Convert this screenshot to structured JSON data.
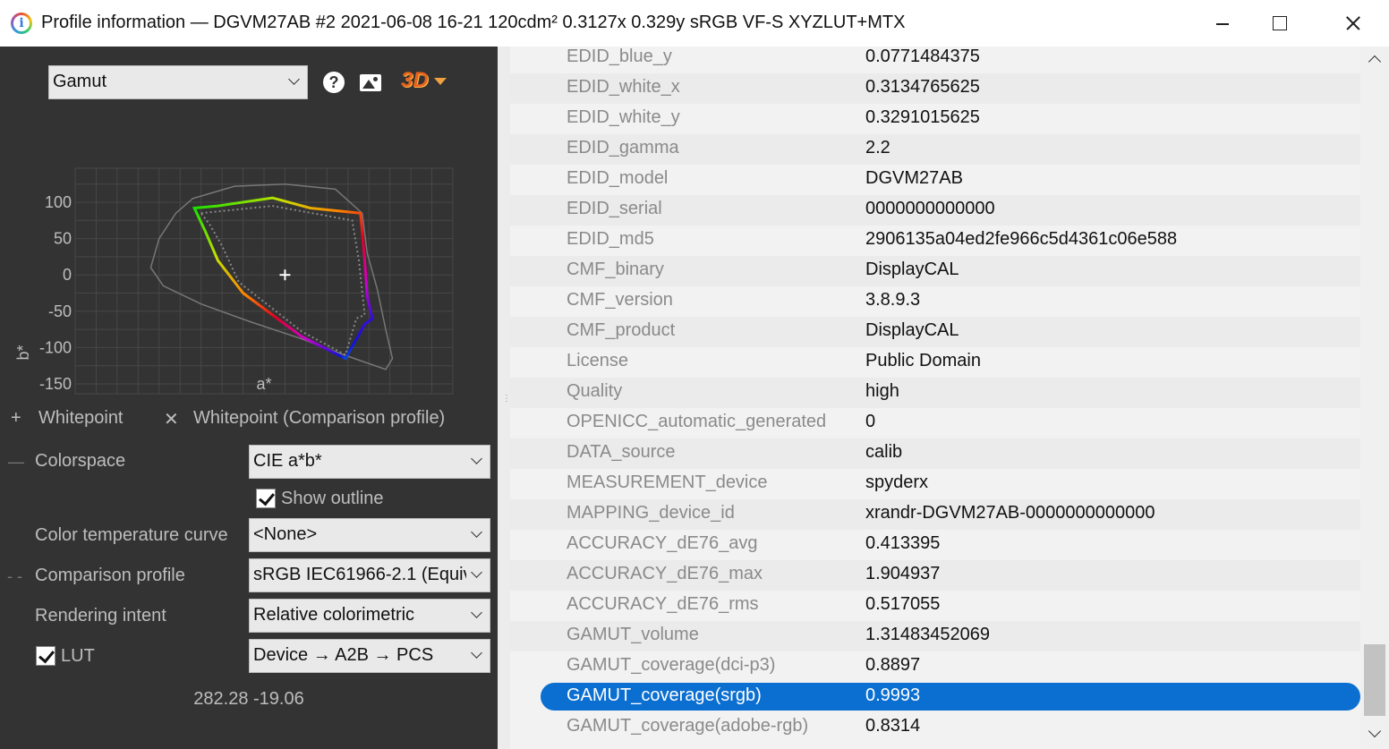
{
  "window": {
    "title": "Profile information — DGVM27AB #2 2021-06-08 16-21 120cdm² 0.3127x 0.329y sRGB VF-S XYZLUT+MTX",
    "app_icon_glyph": "i"
  },
  "toolbar": {
    "view_select": "Gamut",
    "help_icon": "?",
    "threed_label": "3D"
  },
  "chart_data": {
    "type": "scatter",
    "xlabel": "a*",
    "ylabel": "b*",
    "xlim": [
      -250,
      200
    ],
    "ylim": [
      -150,
      100
    ],
    "xticks": [
      "-250",
      "-200",
      "-150",
      "-100",
      "-50",
      "0",
      "50",
      "100",
      "150",
      "200"
    ],
    "yticks": [
      "100",
      "50",
      "0",
      "-50",
      "-100",
      "-150"
    ],
    "grid": true,
    "whitepoint": [
      0,
      0
    ],
    "series": [
      {
        "style": "thin-outline-visible-spectrum",
        "color": "#777777",
        "points": [
          [
            -110,
            105
          ],
          [
            -60,
            122
          ],
          [
            0,
            125
          ],
          [
            60,
            118
          ],
          [
            92,
            85
          ],
          [
            98,
            30
          ],
          [
            110,
            -20
          ],
          [
            120,
            -75
          ],
          [
            128,
            -115
          ],
          [
            120,
            -130
          ],
          [
            70,
            -110
          ],
          [
            20,
            -88
          ],
          [
            -40,
            -65
          ],
          [
            -100,
            -40
          ],
          [
            -145,
            -15
          ],
          [
            -160,
            10
          ],
          [
            -150,
            50
          ],
          [
            -130,
            85
          ],
          [
            -110,
            105
          ]
        ]
      },
      {
        "style": "colored-gamut-outline",
        "points": [
          [
            -108,
            92
          ],
          [
            -80,
            95
          ],
          [
            -15,
            106
          ],
          [
            30,
            92
          ],
          [
            90,
            85
          ],
          [
            95,
            20
          ],
          [
            98,
            -30
          ],
          [
            104,
            -60
          ],
          [
            95,
            -68
          ],
          [
            72,
            -115
          ],
          [
            20,
            -85
          ],
          [
            -50,
            -25
          ],
          [
            -80,
            20
          ],
          [
            -95,
            60
          ],
          [
            -108,
            92
          ]
        ]
      },
      {
        "style": "dotted-comparison-outline",
        "color": "#888888",
        "points": [
          [
            -100,
            85
          ],
          [
            -15,
            95
          ],
          [
            80,
            75
          ],
          [
            88,
            20
          ],
          [
            95,
            -55
          ],
          [
            85,
            -60
          ],
          [
            72,
            -110
          ],
          [
            20,
            -78
          ],
          [
            -55,
            -10
          ],
          [
            -75,
            40
          ],
          [
            -90,
            70
          ],
          [
            -100,
            85
          ]
        ]
      }
    ]
  },
  "legend": {
    "whitepoint_symbol": "+",
    "whitepoint_label": "Whitepoint",
    "comparison_symbol": "✕",
    "comparison_label": "Whitepoint (Comparison profile)"
  },
  "controls": {
    "colorspace_label": "Colorspace",
    "colorspace_value": "CIE a*b*",
    "show_outline_label": "Show outline",
    "show_outline_checked": true,
    "color_temp_label": "Color temperature curve",
    "color_temp_value": "<None>",
    "comparison_label": "Comparison profile",
    "comparison_value": "sRGB IEC61966-2.1 (Equiv",
    "rendering_intent_label": "Rendering intent",
    "rendering_intent_value": "Relative colorimetric",
    "lut_label": "LUT",
    "lut_checked": true,
    "lut_value": "Device → A2B → PCS",
    "coords_readout": "282.28 -19.06"
  },
  "table": {
    "rows": [
      {
        "key": "EDID_blue_y",
        "value": "0.0771484375"
      },
      {
        "key": "EDID_white_x",
        "value": "0.3134765625"
      },
      {
        "key": "EDID_white_y",
        "value": "0.3291015625"
      },
      {
        "key": "EDID_gamma",
        "value": "2.2"
      },
      {
        "key": "EDID_model",
        "value": "DGVM27AB"
      },
      {
        "key": "EDID_serial",
        "value": "0000000000000"
      },
      {
        "key": "EDID_md5",
        "value": "2906135a04ed2fe966c5d4361c06e588"
      },
      {
        "key": "CMF_binary",
        "value": "DisplayCAL"
      },
      {
        "key": "CMF_version",
        "value": "3.8.9.3"
      },
      {
        "key": "CMF_product",
        "value": "DisplayCAL"
      },
      {
        "key": "License",
        "value": "Public Domain"
      },
      {
        "key": "Quality",
        "value": "high"
      },
      {
        "key": "OPENICC_automatic_generated",
        "value": "0"
      },
      {
        "key": "DATA_source",
        "value": "calib"
      },
      {
        "key": "MEASUREMENT_device",
        "value": "spyderx"
      },
      {
        "key": "MAPPING_device_id",
        "value": "xrandr-DGVM27AB-0000000000000"
      },
      {
        "key": "ACCURACY_dE76_avg",
        "value": "0.413395"
      },
      {
        "key": "ACCURACY_dE76_max",
        "value": "1.904937"
      },
      {
        "key": "ACCURACY_dE76_rms",
        "value": "0.517055"
      },
      {
        "key": "GAMUT_volume",
        "value": "1.31483452069"
      },
      {
        "key": "GAMUT_coverage(dci-p3)",
        "value": "0.8897"
      },
      {
        "key": "GAMUT_coverage(srgb)",
        "value": "0.9993"
      },
      {
        "key": "GAMUT_coverage(adobe-rgb)",
        "value": "0.8314"
      }
    ],
    "selected_key": "GAMUT_coverage(srgb)"
  },
  "colors": {
    "panel_dark": "#333333",
    "selection_blue": "#0a6fd1",
    "dotted_outline": "#888888",
    "spectrum_outline": "#777777"
  }
}
